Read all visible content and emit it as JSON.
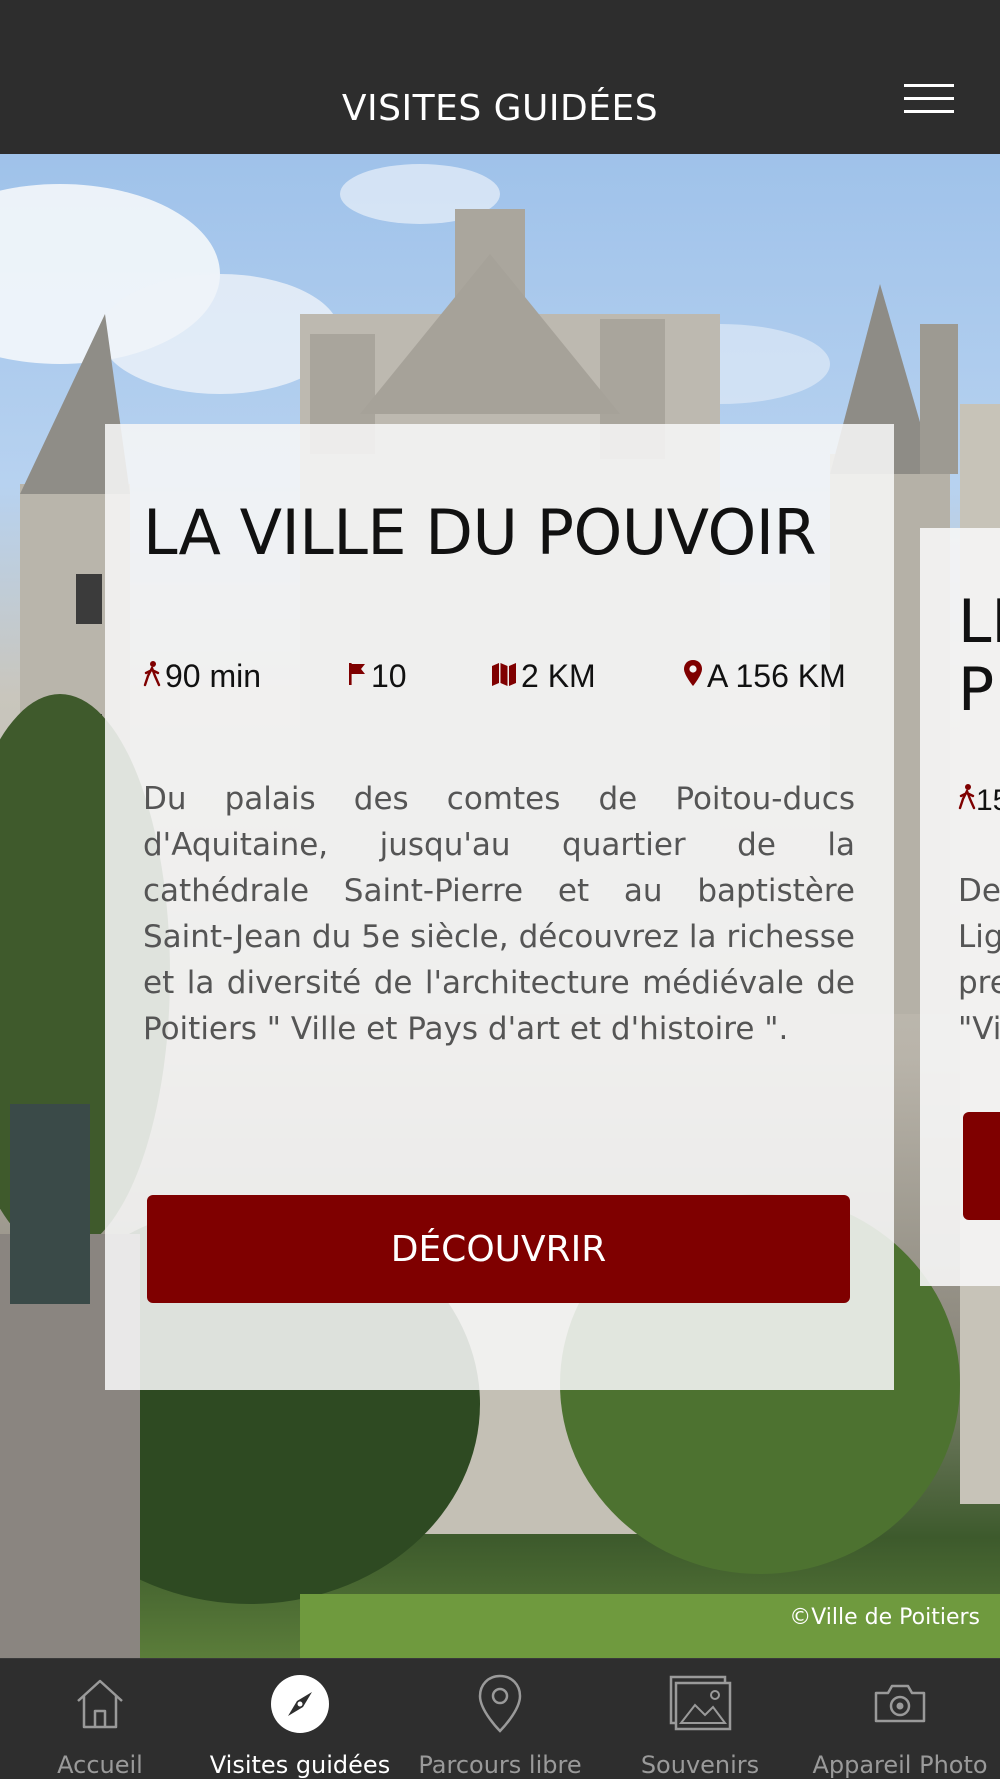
{
  "header": {
    "title": "VISITES GUIDÉES"
  },
  "photo_credit": "©Ville de Poitiers",
  "tour_card": {
    "title": "LA VILLE DU POUVOIR",
    "stats": {
      "duration": "90 min",
      "stops": "10",
      "distance": "2 KM",
      "location": "A 156 KM"
    },
    "description": "Du palais des comtes de Poitou-ducs d'Aquitaine, jusqu'au quartier de la cathédrale Saint-Pierre et au baptistère Saint-Jean du 5e siècle, découvrez la richesse et la diversité de l'architecture médiévale de Poitiers \" Ville et Pays d'art et d'histoire \".",
    "button_label": "DÉCOUVRIR"
  },
  "next_card": {
    "title_line1": "LI",
    "title_line2": "P",
    "duration": "15",
    "desc_lines": [
      "De",
      "Lig",
      "pre",
      "\"Vi"
    ]
  },
  "tabs": [
    {
      "label": "Accueil",
      "icon": "home-icon",
      "active": false
    },
    {
      "label": "Visites guidées",
      "icon": "compass-icon",
      "active": true
    },
    {
      "label": "Parcours libre",
      "icon": "map-pin-icon",
      "active": false
    },
    {
      "label": "Souvenirs",
      "icon": "photos-icon",
      "active": false
    },
    {
      "label": "Appareil Photo",
      "icon": "camera-icon",
      "active": false
    }
  ],
  "colors": {
    "accent": "#7f0000",
    "header_bg": "#2d2d2d",
    "tabbar_bg": "#2e2e2e"
  }
}
